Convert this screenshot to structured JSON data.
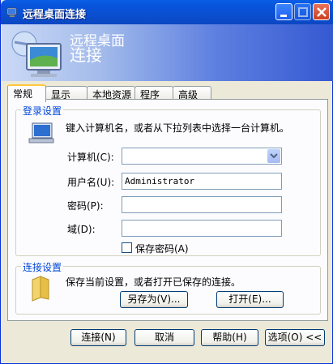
{
  "window": {
    "title": "远程桌面连接"
  },
  "banner": {
    "line1": "远程桌面",
    "line2": "连接"
  },
  "tabs": [
    {
      "label": "常规"
    },
    {
      "label": "显示"
    },
    {
      "label": "本地资源"
    },
    {
      "label": "程序"
    },
    {
      "label": "高级"
    }
  ],
  "login": {
    "group_label": "登录设置",
    "instruction": "键入计算机名，或者从下拉列表中选择一台计算机。",
    "computer_label": "计算机(C):",
    "computer_value": "",
    "username_label": "用户名(U):",
    "username_value": "Administrator",
    "password_label": "密码(P):",
    "password_value": "",
    "domain_label": "域(D):",
    "domain_value": "",
    "save_password_label": "保存密码(A)",
    "save_password_checked": false
  },
  "connection": {
    "group_label": "连接设置",
    "instruction": "保存当前设置，或者打开已保存的连接。",
    "save_as_label": "另存为(V)...",
    "open_label": "打开(E)..."
  },
  "footer": {
    "connect_label": "连接(N)",
    "cancel_label": "取消",
    "help_label": "帮助(H)",
    "options_label": "选项(O) <<"
  },
  "colors": {
    "accent": "#0046d5",
    "title_bar": "#0a5fe6"
  }
}
